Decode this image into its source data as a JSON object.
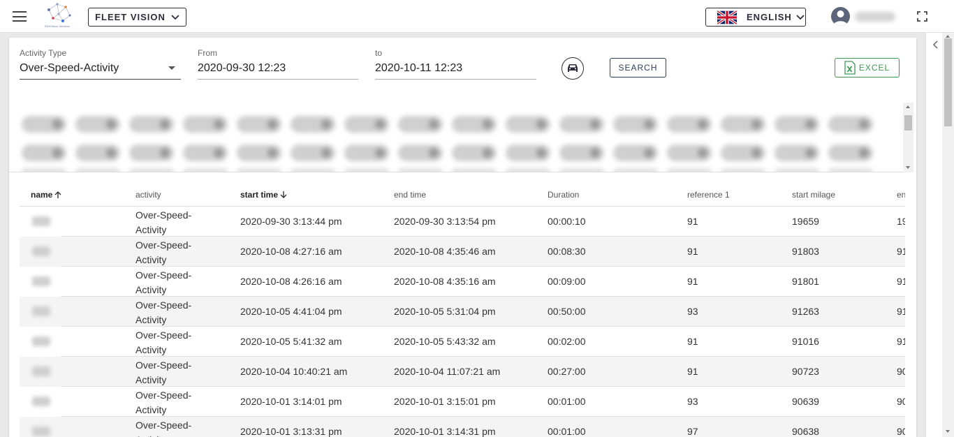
{
  "header": {
    "fleet_label": "FLEET VISION",
    "language_label": "ENGLISH",
    "logo_caption": "EDHVision Services"
  },
  "filters": {
    "activity_type_label": "Activity Type",
    "activity_type_value": "Over-Speed-Activity",
    "from_label": "From",
    "from_value": "2020-09-30 12:23",
    "to_label": "to",
    "to_value": "2020-10-11 12:23",
    "search_label": "SEARCH",
    "excel_label": "EXCEL"
  },
  "table": {
    "columns": [
      "name",
      "activity",
      "start time",
      "end time",
      "Duration",
      "reference 1",
      "start milage",
      "en"
    ],
    "rows": [
      {
        "activity": "Over-Speed-Activity",
        "start": "2020-09-30 3:13:44 pm",
        "end": "2020-09-30 3:13:54 pm",
        "duration": "00:00:10",
        "ref": "91",
        "start_milage": "19659",
        "end_milage": "19"
      },
      {
        "activity": "Over-Speed-Activity",
        "start": "2020-10-08 4:27:16 am",
        "end": "2020-10-08 4:35:46 am",
        "duration": "00:08:30",
        "ref": "91",
        "start_milage": "91803",
        "end_milage": "91"
      },
      {
        "activity": "Over-Speed-Activity",
        "start": "2020-10-08 4:26:16 am",
        "end": "2020-10-08 4:35:16 am",
        "duration": "00:09:00",
        "ref": "91",
        "start_milage": "91801",
        "end_milage": "91"
      },
      {
        "activity": "Over-Speed-Activity",
        "start": "2020-10-05 4:41:04 pm",
        "end": "2020-10-05 5:31:04 pm",
        "duration": "00:50:00",
        "ref": "93",
        "start_milage": "91263",
        "end_milage": "91"
      },
      {
        "activity": "Over-Speed-Activity",
        "start": "2020-10-05 5:41:32 am",
        "end": "2020-10-05 5:43:32 am",
        "duration": "00:02:00",
        "ref": "91",
        "start_milage": "91016",
        "end_milage": "91"
      },
      {
        "activity": "Over-Speed-Activity",
        "start": "2020-10-04 10:40:21 am",
        "end": "2020-10-04 11:07:21 am",
        "duration": "00:27:00",
        "ref": "91",
        "start_milage": "90723",
        "end_milage": "90"
      },
      {
        "activity": "Over-Speed-Activity",
        "start": "2020-10-01 3:14:01 pm",
        "end": "2020-10-01 3:15:01 pm",
        "duration": "00:01:00",
        "ref": "93",
        "start_milage": "90639",
        "end_milage": "90"
      },
      {
        "activity": "Over-Speed-Activity",
        "start": "2020-10-01 3:13:31 pm",
        "end": "2020-10-01 3:14:31 pm",
        "duration": "00:01:00",
        "ref": "97",
        "start_milage": "90638",
        "end_milage": "90"
      }
    ]
  },
  "colors": {
    "excel_green": "#3a9a50",
    "border_dark": "#2c2c3a",
    "row_alt": "#f4f4f4"
  }
}
